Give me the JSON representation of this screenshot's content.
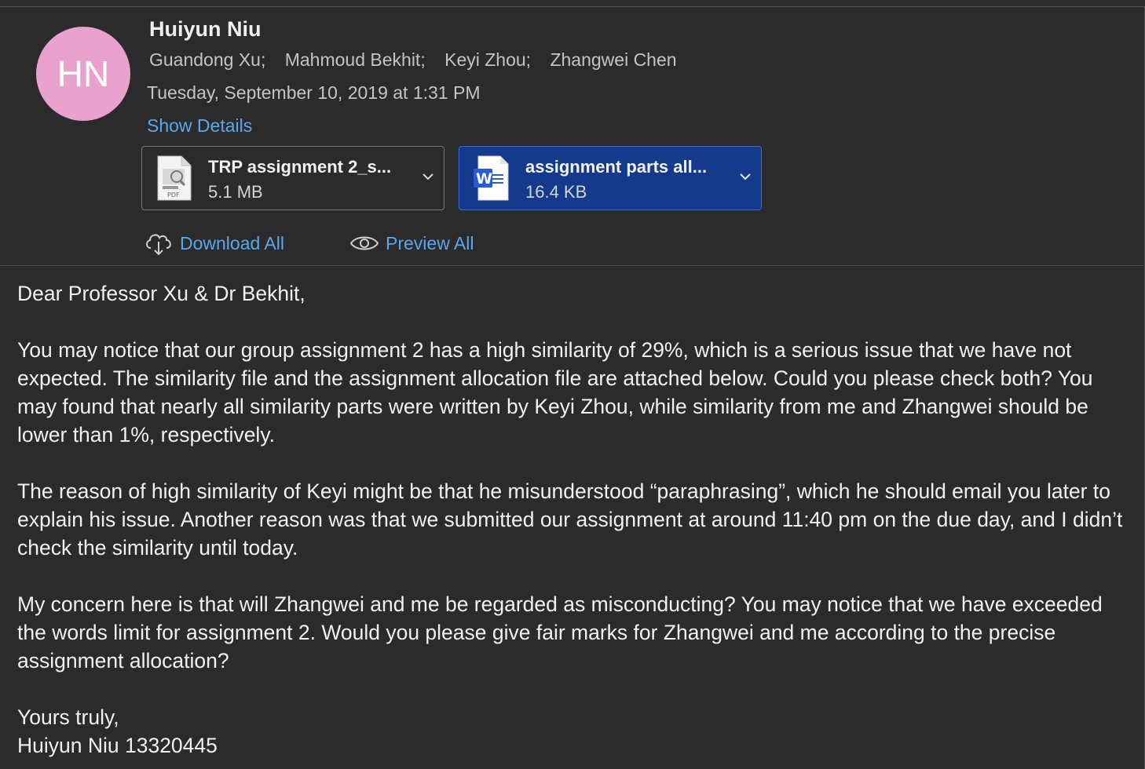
{
  "email": {
    "avatar_initials": "HN",
    "avatar_color": "#e8a2cd",
    "sender": "Huiyun Niu",
    "recipients": [
      "Guandong Xu;",
      "Mahmoud Bekhit;",
      "Keyi Zhou;",
      "Zhangwei Chen"
    ],
    "date": "Tuesday, September 10, 2019 at 1:31 PM",
    "show_details_label": "Show Details"
  },
  "attachments": [
    {
      "name": "TRP assignment 2_s...",
      "size": "5.1 MB",
      "icon": "pdf-file-icon",
      "type_label": "PDF",
      "selected": false
    },
    {
      "name": "assignment parts all...",
      "size": "16.4 KB",
      "icon": "word-document-icon",
      "selected": true
    }
  ],
  "actions": {
    "download_all": "Download All",
    "preview_all": "Preview All"
  },
  "body": {
    "greeting": "Dear Professor Xu & Dr Bekhit,",
    "paragraphs": [
      "You may notice that our group assignment 2 has a high similarity of 29%, which is a serious issue that we have not expected. The similarity file and the assignment allocation file are attached below. Could you please check both? You may found that nearly all similarity parts were written by Keyi Zhou, while similarity from me and Zhangwei should be lower than 1%, respectively.",
      "The reason of high similarity of Keyi might be that he misunderstood “paraphrasing”, which he should email you later to explain his issue. Another reason was that we submitted our assignment at around 11:40 pm on the due day, and I didn’t check the similarity until today.",
      "My concern here is that will Zhangwei and me be regarded as misconducting? You may notice that we have exceeded the words limit for assignment 2. Would you please give fair marks for Zhangwei and me according to the precise assignment allocation?"
    ],
    "closing": "Yours truly,",
    "signature": "Huiyun Niu 13320445"
  },
  "colors": {
    "background": "#2b2b2b",
    "link": "#5aa7f0",
    "selected_attachment": "#153a8c"
  }
}
